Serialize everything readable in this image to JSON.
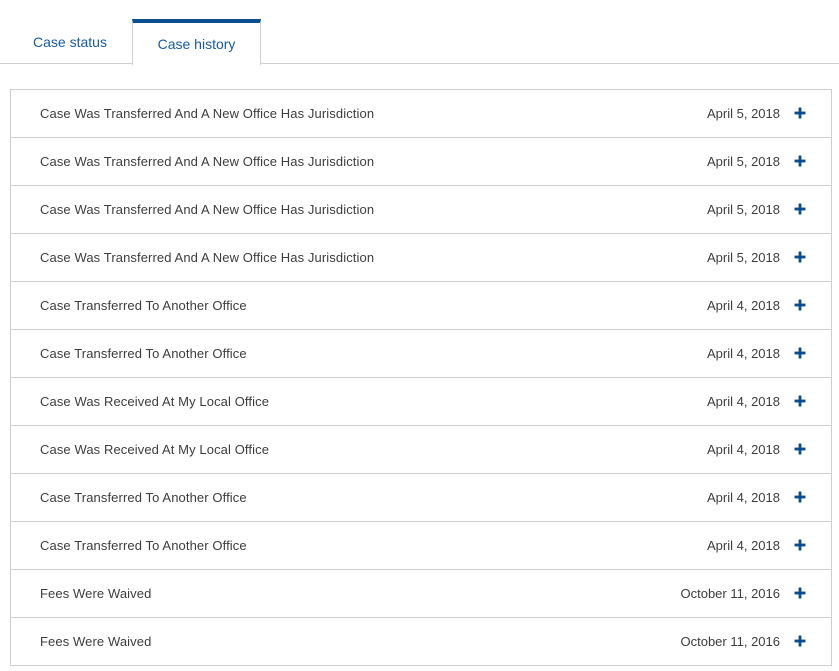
{
  "tabs": {
    "status_label": "Case status",
    "history_label": "Case history"
  },
  "accent_color": "#0b4f8f",
  "history": [
    {
      "title": "Case Was Transferred And A New Office Has Jurisdiction",
      "date": "April 5, 2018"
    },
    {
      "title": "Case Was Transferred And A New Office Has Jurisdiction",
      "date": "April 5, 2018"
    },
    {
      "title": "Case Was Transferred And A New Office Has Jurisdiction",
      "date": "April 5, 2018"
    },
    {
      "title": "Case Was Transferred And A New Office Has Jurisdiction",
      "date": "April 5, 2018"
    },
    {
      "title": "Case Transferred To Another Office",
      "date": "April 4, 2018"
    },
    {
      "title": "Case Transferred To Another Office",
      "date": "April 4, 2018"
    },
    {
      "title": "Case Was Received At My Local Office",
      "date": "April 4, 2018"
    },
    {
      "title": "Case Was Received At My Local Office",
      "date": "April 4, 2018"
    },
    {
      "title": "Case Transferred To Another Office",
      "date": "April 4, 2018"
    },
    {
      "title": "Case Transferred To Another Office",
      "date": "April 4, 2018"
    },
    {
      "title": "Fees Were Waived",
      "date": "October 11, 2016"
    },
    {
      "title": "Fees Were Waived",
      "date": "October 11, 2016"
    }
  ],
  "expand_icon": "plus-icon"
}
